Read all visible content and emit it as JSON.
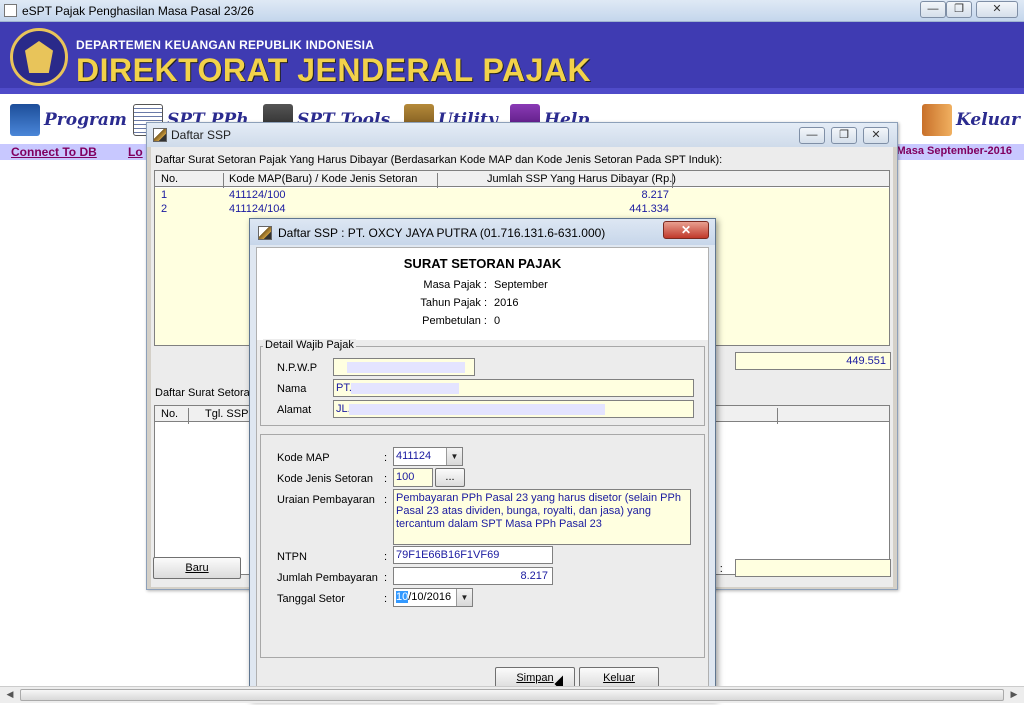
{
  "app": {
    "title": "eSPT Pajak Penghasilan Masa Pasal 23/26",
    "minimize": "—",
    "maximize": "❐",
    "close": "✕"
  },
  "banner": {
    "department": "DEPARTEMEN KEUANGAN REPUBLIK INDONESIA",
    "directorate": "DIREKTORAT JENDERAL PAJAK"
  },
  "menu": {
    "program": "Program",
    "spt_pph": "SPT PPh",
    "spt_tools": "SPT Tools",
    "utility": "Utility",
    "help": "Help",
    "keluar": "Keluar"
  },
  "strip": {
    "connect": "Connect To DB",
    "lo": "Lo",
    "masa": "Masa September-2016"
  },
  "ssp_window": {
    "title": "Daftar SSP",
    "caption_top": "Daftar Surat Setoran Pajak Yang Harus Dibayar (Berdasarkan Kode MAP dan Kode Jenis Setoran Pada SPT Induk):",
    "columns": [
      "No.",
      "Kode MAP(Baru) / Kode Jenis Setoran",
      "Jumlah SSP Yang Harus Dibayar (Rp.)"
    ],
    "rows": [
      {
        "no": "1",
        "kode": "411124/100",
        "jumlah": "8.217"
      },
      {
        "no": "2",
        "kode": "411124/104",
        "jumlah": "441.334"
      }
    ],
    "total": "449.551",
    "caption_bottom": "Daftar Surat Setora",
    "columns_bottom": [
      "No.",
      "Tgl. SSP"
    ],
    "baru_label": "Baru",
    "bottom_label": ") :"
  },
  "dialog": {
    "title": "Daftar SSP : PT. OXCY JAYA PUTRA (01.716.131.6-631.000)",
    "close": "✕",
    "heading": "SURAT SETORAN PAJAK",
    "masa_label": "Masa Pajak :",
    "masa_value": "September",
    "tahun_label": "Tahun Pajak :",
    "tahun_value": "2016",
    "pembetulan_label": "Pembetulan :",
    "pembetulan_value": "0",
    "detail_group": "Detail Wajib Pajak",
    "npwp_label": "N.P.W.P",
    "npwp_value": "",
    "nama_label": "Nama",
    "nama_value": "PT.",
    "alamat_label": "Alamat",
    "alamat_value": "JL.",
    "kode_map_label": "Kode MAP",
    "kode_map_value": "411124",
    "kode_jenis_label": "Kode Jenis Setoran",
    "kode_jenis_value": "100",
    "browse_label": "...",
    "uraian_label": "Uraian Pembayaran",
    "uraian_value": "Pembayaran PPh Pasal 23 yang harus disetor (selain PPh Pasal 23 atas dividen, bunga, royalti, dan jasa) yang tercantum dalam SPT Masa PPh Pasal 23",
    "ntpn_label": "NTPN",
    "ntpn_value": "79F1E66B16F1VF69",
    "jumlah_label": "Jumlah  Pembayaran",
    "jumlah_value": "8.217",
    "tanggal_label": "Tanggal Setor",
    "tanggal_day": "10",
    "tanggal_rest": "/10/2016",
    "colon": ":",
    "simpan": "Simpan",
    "keluar": "Keluar"
  }
}
